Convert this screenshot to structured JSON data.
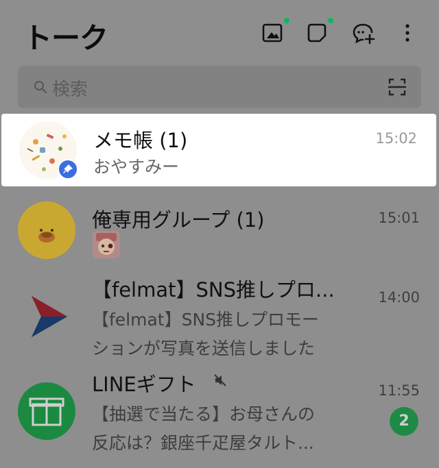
{
  "header": {
    "title": "トーク"
  },
  "search": {
    "placeholder": "検索"
  },
  "chats": [
    {
      "name": "メモ帳 (1)",
      "preview": "おやすみー",
      "time": "15:02",
      "pinned": true
    },
    {
      "name": "俺専用グループ (1)",
      "preview": "",
      "time": "15:01"
    },
    {
      "name": "【felmat】SNS推しプロ...",
      "preview": "【felmat】SNS推しプロモー\nションが写真を送信しました",
      "time": "14:00"
    },
    {
      "name": "LINEギフト",
      "preview": "【抽選で当たる】お母さんの\n反応は？銀座千疋屋タルト...",
      "time": "11:55",
      "badge": "2",
      "muted": true
    }
  ],
  "colors": {
    "accent_green": "#0bb75d",
    "badge_green": "#1f8a46",
    "pin_blue": "#3c6ee0",
    "dim_overlay": "#8e8e8e"
  }
}
